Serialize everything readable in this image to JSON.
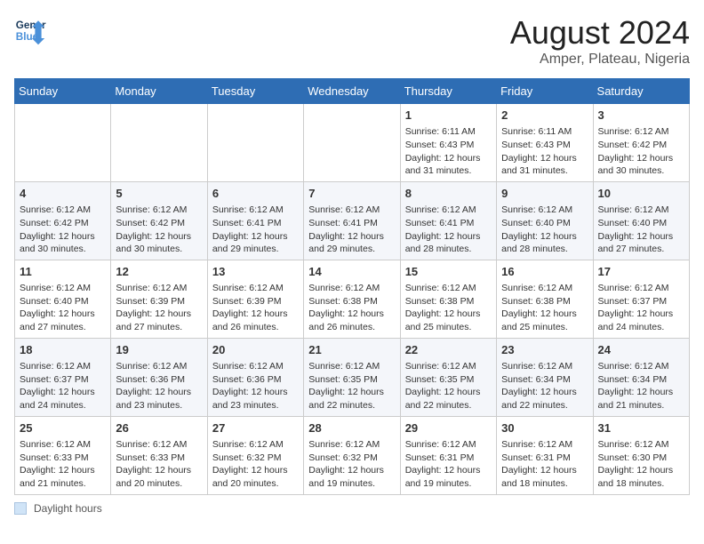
{
  "logo": {
    "line1": "General",
    "line2": "Blue"
  },
  "title": "August 2024",
  "subtitle": "Amper, Plateau, Nigeria",
  "days_of_week": [
    "Sunday",
    "Monday",
    "Tuesday",
    "Wednesday",
    "Thursday",
    "Friday",
    "Saturday"
  ],
  "footer": {
    "legend_label": "Daylight hours"
  },
  "weeks": [
    [
      {
        "day": "",
        "info": ""
      },
      {
        "day": "",
        "info": ""
      },
      {
        "day": "",
        "info": ""
      },
      {
        "day": "",
        "info": ""
      },
      {
        "day": "1",
        "info": "Sunrise: 6:11 AM\nSunset: 6:43 PM\nDaylight: 12 hours and 31 minutes."
      },
      {
        "day": "2",
        "info": "Sunrise: 6:11 AM\nSunset: 6:43 PM\nDaylight: 12 hours and 31 minutes."
      },
      {
        "day": "3",
        "info": "Sunrise: 6:12 AM\nSunset: 6:42 PM\nDaylight: 12 hours and 30 minutes."
      }
    ],
    [
      {
        "day": "4",
        "info": "Sunrise: 6:12 AM\nSunset: 6:42 PM\nDaylight: 12 hours and 30 minutes."
      },
      {
        "day": "5",
        "info": "Sunrise: 6:12 AM\nSunset: 6:42 PM\nDaylight: 12 hours and 30 minutes."
      },
      {
        "day": "6",
        "info": "Sunrise: 6:12 AM\nSunset: 6:41 PM\nDaylight: 12 hours and 29 minutes."
      },
      {
        "day": "7",
        "info": "Sunrise: 6:12 AM\nSunset: 6:41 PM\nDaylight: 12 hours and 29 minutes."
      },
      {
        "day": "8",
        "info": "Sunrise: 6:12 AM\nSunset: 6:41 PM\nDaylight: 12 hours and 28 minutes."
      },
      {
        "day": "9",
        "info": "Sunrise: 6:12 AM\nSunset: 6:40 PM\nDaylight: 12 hours and 28 minutes."
      },
      {
        "day": "10",
        "info": "Sunrise: 6:12 AM\nSunset: 6:40 PM\nDaylight: 12 hours and 27 minutes."
      }
    ],
    [
      {
        "day": "11",
        "info": "Sunrise: 6:12 AM\nSunset: 6:40 PM\nDaylight: 12 hours and 27 minutes."
      },
      {
        "day": "12",
        "info": "Sunrise: 6:12 AM\nSunset: 6:39 PM\nDaylight: 12 hours and 27 minutes."
      },
      {
        "day": "13",
        "info": "Sunrise: 6:12 AM\nSunset: 6:39 PM\nDaylight: 12 hours and 26 minutes."
      },
      {
        "day": "14",
        "info": "Sunrise: 6:12 AM\nSunset: 6:38 PM\nDaylight: 12 hours and 26 minutes."
      },
      {
        "day": "15",
        "info": "Sunrise: 6:12 AM\nSunset: 6:38 PM\nDaylight: 12 hours and 25 minutes."
      },
      {
        "day": "16",
        "info": "Sunrise: 6:12 AM\nSunset: 6:38 PM\nDaylight: 12 hours and 25 minutes."
      },
      {
        "day": "17",
        "info": "Sunrise: 6:12 AM\nSunset: 6:37 PM\nDaylight: 12 hours and 24 minutes."
      }
    ],
    [
      {
        "day": "18",
        "info": "Sunrise: 6:12 AM\nSunset: 6:37 PM\nDaylight: 12 hours and 24 minutes."
      },
      {
        "day": "19",
        "info": "Sunrise: 6:12 AM\nSunset: 6:36 PM\nDaylight: 12 hours and 23 minutes."
      },
      {
        "day": "20",
        "info": "Sunrise: 6:12 AM\nSunset: 6:36 PM\nDaylight: 12 hours and 23 minutes."
      },
      {
        "day": "21",
        "info": "Sunrise: 6:12 AM\nSunset: 6:35 PM\nDaylight: 12 hours and 22 minutes."
      },
      {
        "day": "22",
        "info": "Sunrise: 6:12 AM\nSunset: 6:35 PM\nDaylight: 12 hours and 22 minutes."
      },
      {
        "day": "23",
        "info": "Sunrise: 6:12 AM\nSunset: 6:34 PM\nDaylight: 12 hours and 22 minutes."
      },
      {
        "day": "24",
        "info": "Sunrise: 6:12 AM\nSunset: 6:34 PM\nDaylight: 12 hours and 21 minutes."
      }
    ],
    [
      {
        "day": "25",
        "info": "Sunrise: 6:12 AM\nSunset: 6:33 PM\nDaylight: 12 hours and 21 minutes."
      },
      {
        "day": "26",
        "info": "Sunrise: 6:12 AM\nSunset: 6:33 PM\nDaylight: 12 hours and 20 minutes."
      },
      {
        "day": "27",
        "info": "Sunrise: 6:12 AM\nSunset: 6:32 PM\nDaylight: 12 hours and 20 minutes."
      },
      {
        "day": "28",
        "info": "Sunrise: 6:12 AM\nSunset: 6:32 PM\nDaylight: 12 hours and 19 minutes."
      },
      {
        "day": "29",
        "info": "Sunrise: 6:12 AM\nSunset: 6:31 PM\nDaylight: 12 hours and 19 minutes."
      },
      {
        "day": "30",
        "info": "Sunrise: 6:12 AM\nSunset: 6:31 PM\nDaylight: 12 hours and 18 minutes."
      },
      {
        "day": "31",
        "info": "Sunrise: 6:12 AM\nSunset: 6:30 PM\nDaylight: 12 hours and 18 minutes."
      }
    ]
  ]
}
